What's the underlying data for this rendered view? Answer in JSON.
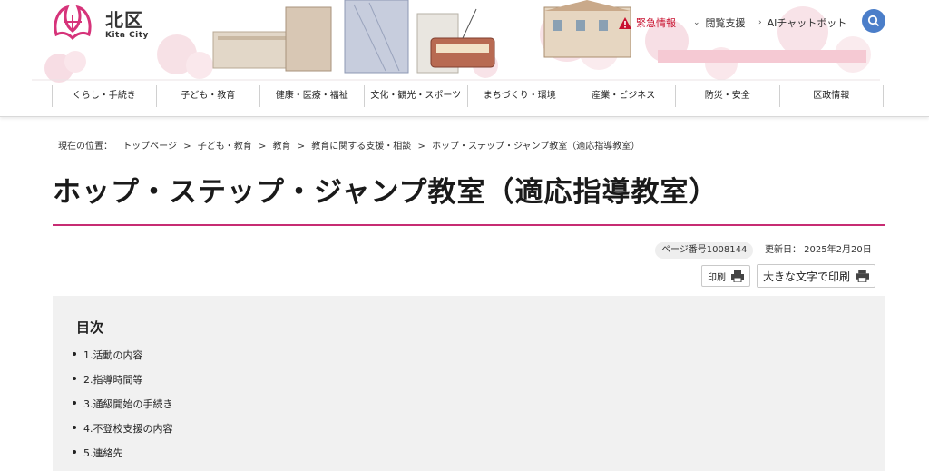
{
  "header": {
    "logo_name": "北区",
    "logo_sub": "Kita City",
    "emergency_label": "緊急情報",
    "accessibility_label": "閲覧支援",
    "chatbot_label": "AIチャットボット",
    "nav": [
      "くらし・手続き",
      "子ども・教育",
      "健康・医療・福祉",
      "文化・観光・スポーツ",
      "まちづくり・環境",
      "産業・ビジネス",
      "防災・安全",
      "区政情報"
    ]
  },
  "breadcrumb": {
    "prefix": "現在の位置：",
    "items": [
      "トップページ",
      "子ども・教育",
      "教育",
      "教育に関する支援・相談",
      "ホップ・ステップ・ジャンプ教室（適応指導教室）"
    ],
    "separator": ">"
  },
  "page": {
    "title": "ホップ・ステップ・ジャンプ教室（適応指導教室）",
    "page_number": "ページ番号1008144",
    "updated": "更新日：  2025年2月20日",
    "print_label": "印刷",
    "print_large_label": "大きな文字で印刷"
  },
  "toc": {
    "title": "目次",
    "items": [
      "1.活動の内容",
      "2.指導時間等",
      "3.通級開始の手続き",
      "4.不登校支援の内容",
      "5.連絡先"
    ]
  },
  "colors": {
    "accent": "#c72c73",
    "emergency": "#c8102e",
    "search": "#4b7ec9"
  }
}
